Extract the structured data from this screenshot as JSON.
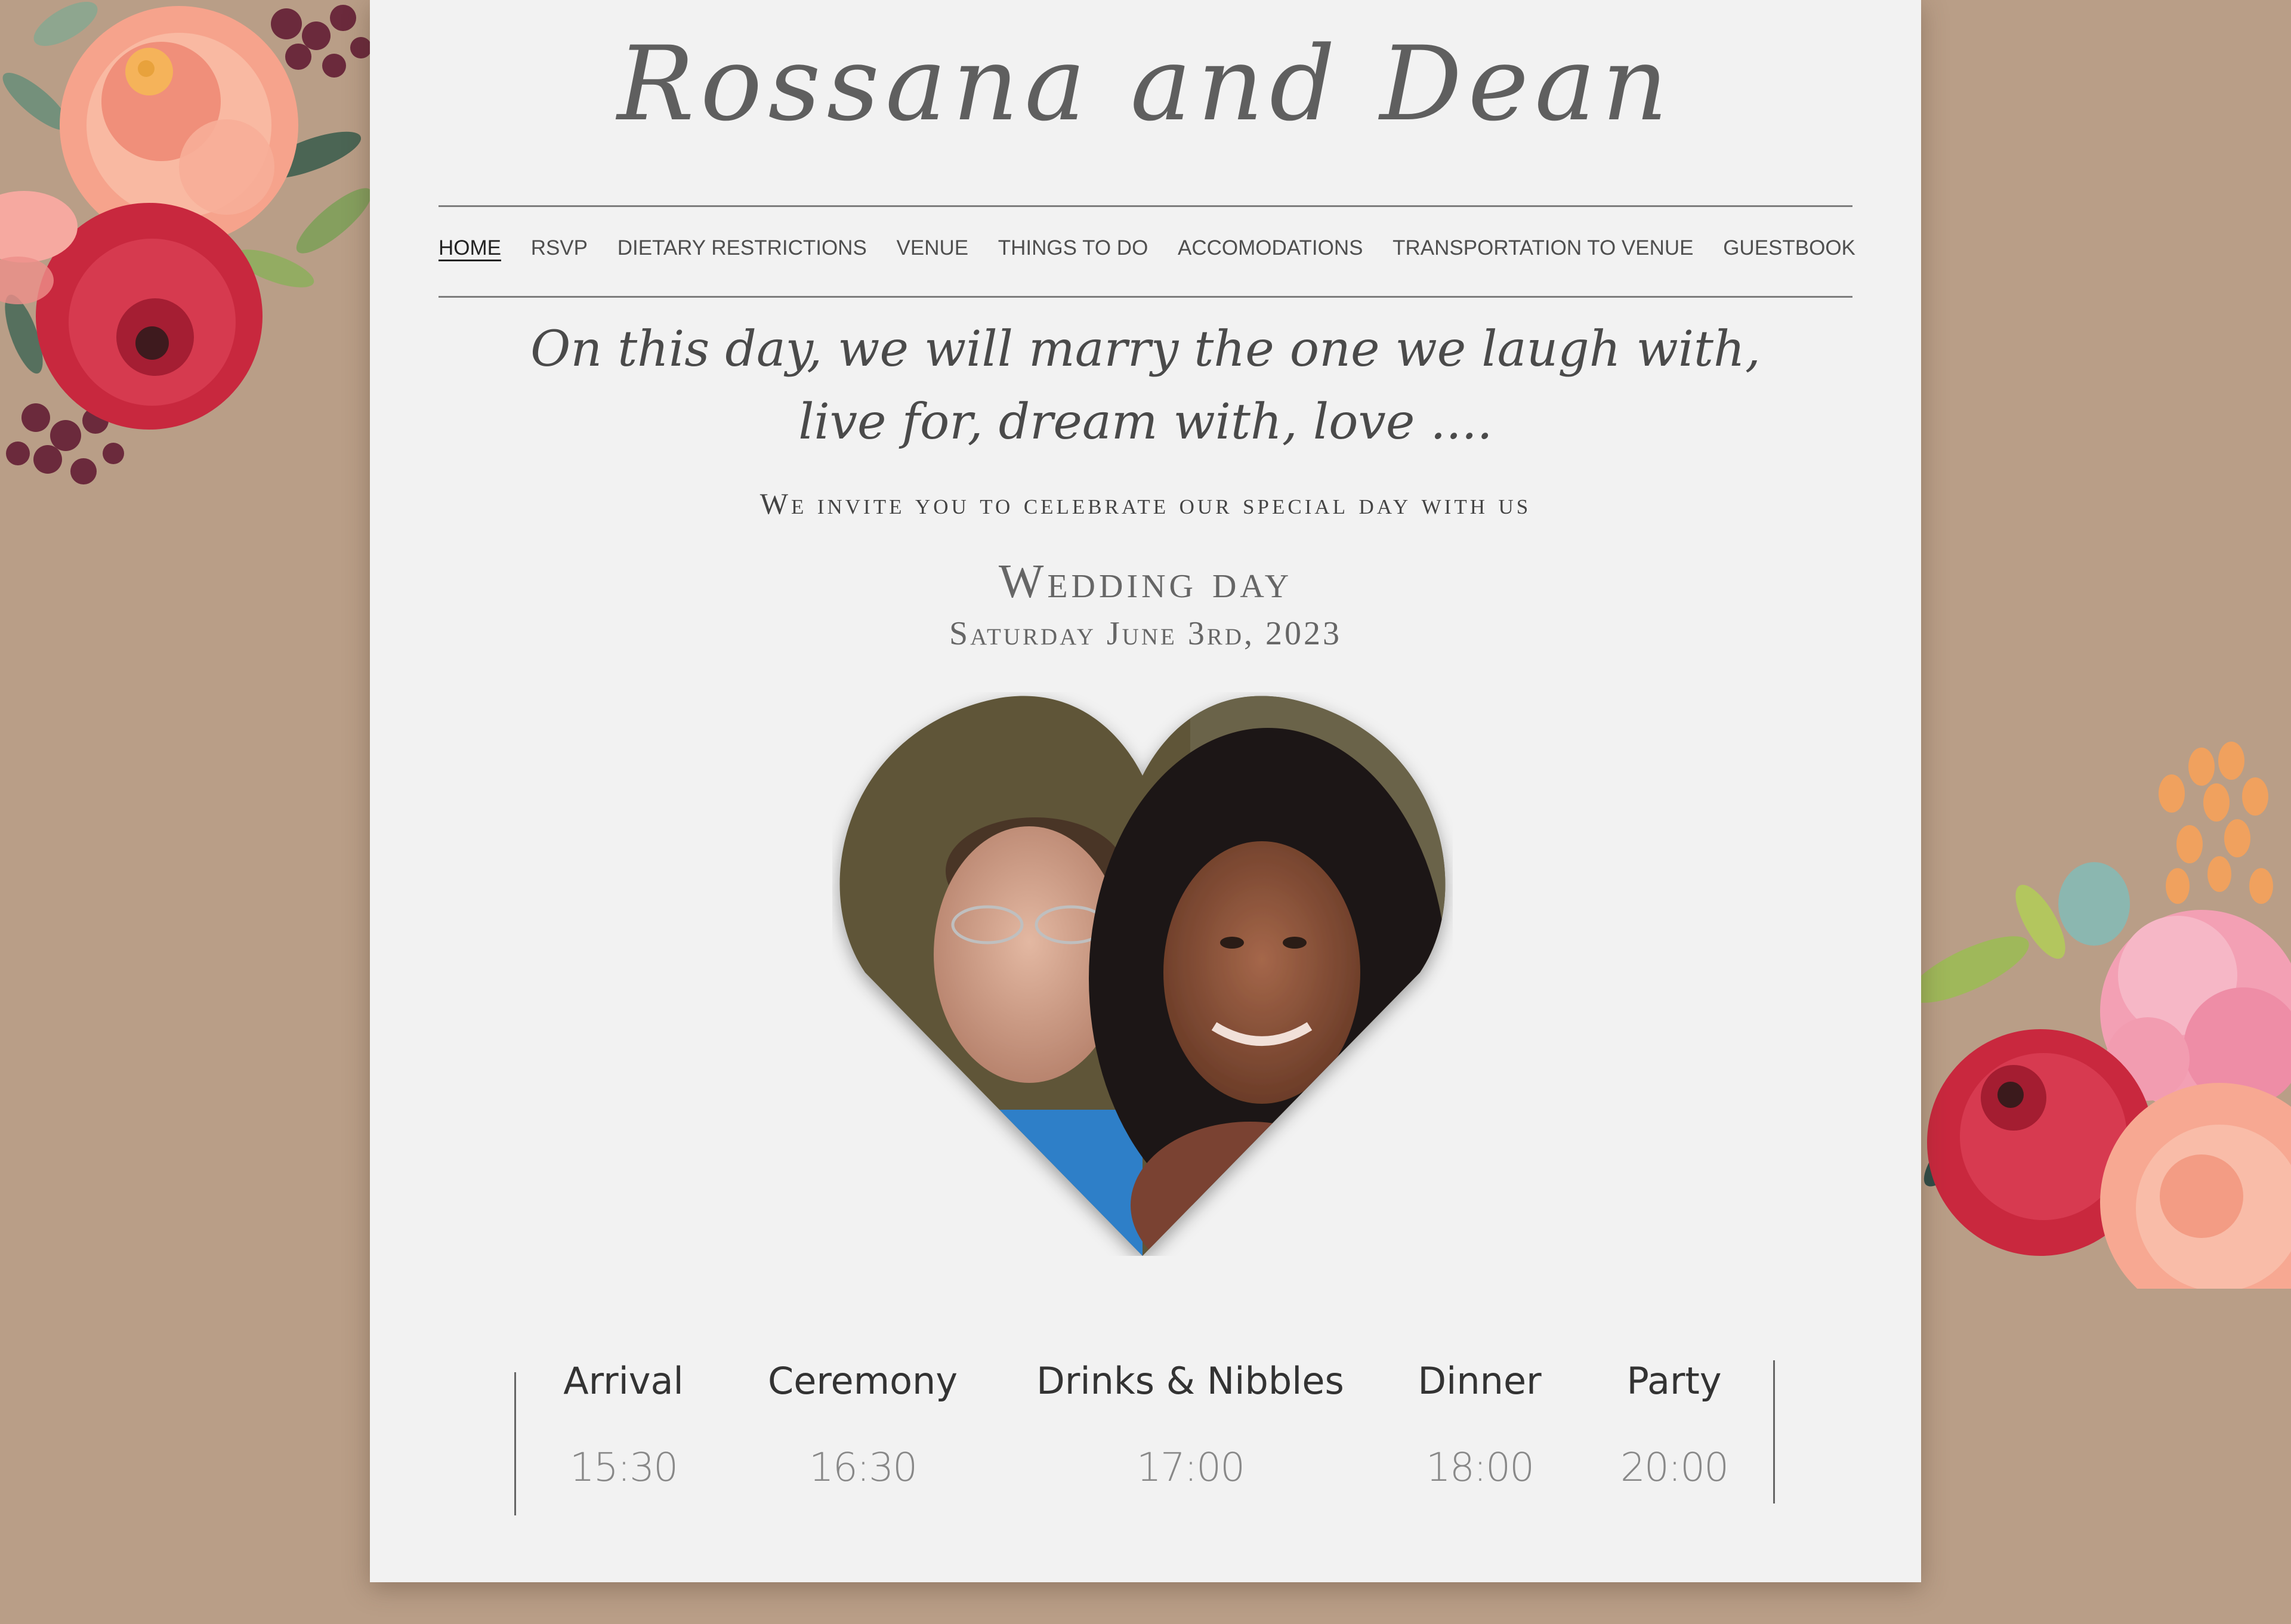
{
  "site": {
    "title": "Rossana and Dean"
  },
  "nav": {
    "items": [
      {
        "label": "HOME",
        "active": true
      },
      {
        "label": "RSVP"
      },
      {
        "label": "DIETARY RESTRICTIONS"
      },
      {
        "label": "VENUE"
      },
      {
        "label": "THINGS TO DO"
      },
      {
        "label": "ACCOMODATIONS"
      },
      {
        "label": "TRANSPORTATION TO VENUE"
      },
      {
        "label": "GUESTBOOK"
      }
    ]
  },
  "hero": {
    "quote_line1": "On this day, we will marry the one we laugh with,",
    "quote_line2": "live for, dream with, love ....",
    "invite": "We invite you to celebrate our special day with us",
    "heading": "Wedding day",
    "date": "Saturday June 3rd, 2023"
  },
  "schedule": [
    {
      "label": "Arrival",
      "time": "15:30"
    },
    {
      "label": "Ceremony",
      "time": "16:30"
    },
    {
      "label": "Drinks & Nibbles",
      "time": "17:00"
    },
    {
      "label": "Dinner",
      "time": "18:00"
    },
    {
      "label": "Party",
      "time": "20:00"
    }
  ],
  "colors": {
    "background": "#b99e87",
    "panel": "#f2f2f2",
    "text": "#4f4f4f"
  }
}
